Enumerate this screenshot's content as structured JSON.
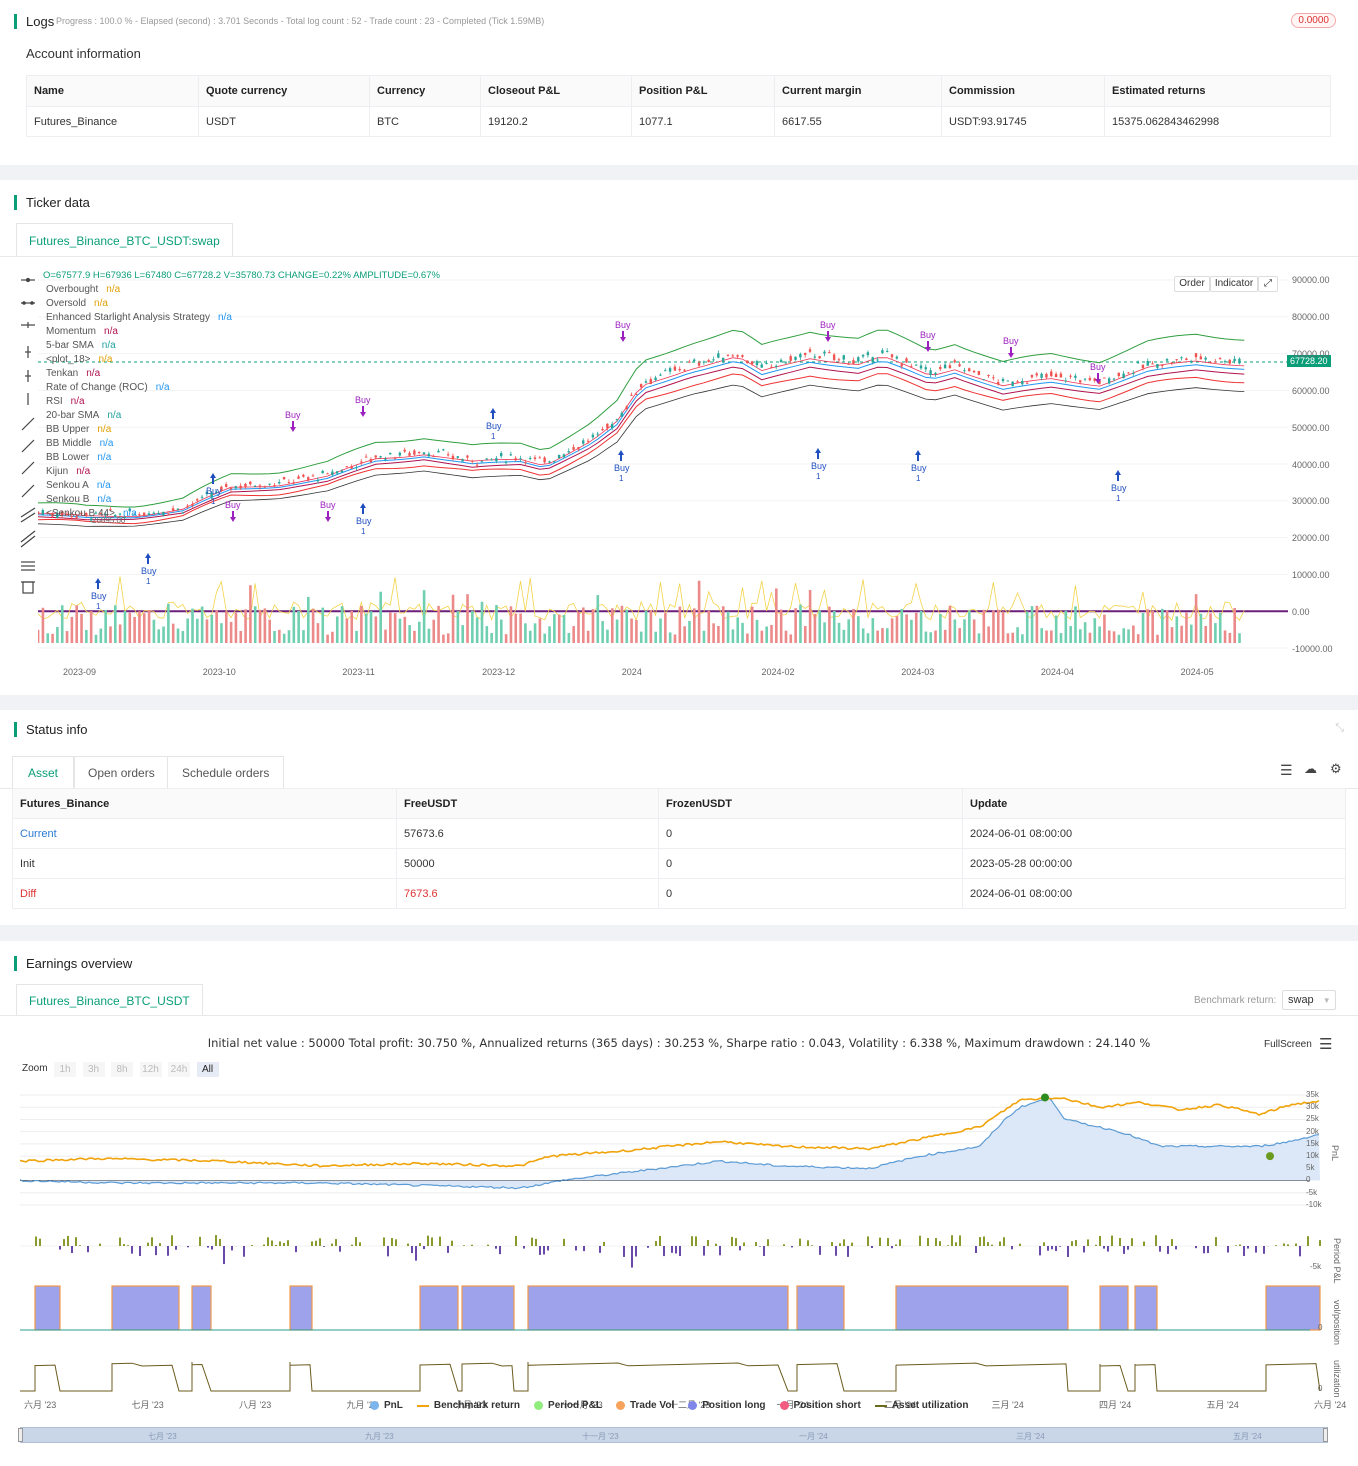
{
  "logs": {
    "title": "Logs",
    "summary": "Progress : 100.0 % - Elapsed (second) : 3.701 Seconds - Total log count : 52 - Trade count : 23 - Completed (Tick 1.59MB)",
    "badge": "0.0000"
  },
  "account": {
    "title": "Account information",
    "columns": [
      "Name",
      "Quote currency",
      "Currency",
      "Closeout P&L",
      "Position P&L",
      "Current margin",
      "Commission",
      "Estimated returns"
    ],
    "row": [
      "Futures_Binance",
      "USDT",
      "BTC",
      "19120.2",
      "1077.1",
      "6617.55",
      "USDT:93.91745",
      "15375.062843462998"
    ]
  },
  "ticker": {
    "title": "Ticker data",
    "tab": "Futures_Binance_BTC_USDT:swap",
    "ohlc": {
      "o": "O=67577.9",
      "h": "H=67936",
      "l": "L=67480",
      "c": "C=67728.2",
      "v": "V=35780.73",
      "change": "CHANGE=0.22%",
      "amp": "AMPLITUDE=0.67%"
    },
    "legend": [
      {
        "name": "Overbought",
        "value": "n/a",
        "color": "#e0a000"
      },
      {
        "name": "Oversold",
        "value": "n/a",
        "color": "#e0a000"
      },
      {
        "name": "Enhanced Starlight Analysis Strategy",
        "value": "n/a",
        "color": "#2196f3"
      },
      {
        "name": "Momentum",
        "value": "n/a",
        "color": "#b0134f"
      },
      {
        "name": "5-bar SMA",
        "value": "n/a",
        "color": "#21a0a0"
      },
      {
        "name": "<plot_18>",
        "value": "n/a",
        "color": "#e0a000"
      },
      {
        "name": "Tenkan",
        "value": "n/a",
        "color": "#b0134f"
      },
      {
        "name": "Rate of Change (ROC)",
        "value": "n/a",
        "color": "#2196f3"
      },
      {
        "name": "RSI",
        "value": "n/a",
        "color": "#b0134f"
      },
      {
        "name": "20-bar SMA",
        "value": "n/a",
        "color": "#21a0a0"
      },
      {
        "name": "BB Upper",
        "value": "n/a",
        "color": "#e0a000"
      },
      {
        "name": "BB Middle",
        "value": "n/a",
        "color": "#2196f3"
      },
      {
        "name": "BB Lower",
        "value": "n/a",
        "color": "#2196f3"
      },
      {
        "name": "Kijun",
        "value": "n/a",
        "color": "#b0134f"
      },
      {
        "name": "Senkou A",
        "value": "n/a",
        "color": "#2196f3"
      },
      {
        "name": "Senkou B",
        "value": "n/a",
        "color": "#2196f3"
      },
      {
        "name": "<Senkou B 44>",
        "value": "n/a",
        "color": "#2196f3"
      }
    ],
    "buttons": {
      "order": "Order",
      "indicator": "Indicator"
    },
    "price_label": "67728.20",
    "y_ticks": [
      "90000.00",
      "80000.00",
      "70000.00",
      "60000.00",
      "50000.00",
      "40000.00",
      "30000.00",
      "20000.00",
      "10000.00",
      "0.00",
      "-10000.00"
    ],
    "x_ticks": [
      "2023-09",
      "2023-10",
      "2023-11",
      "2023-12",
      "2024",
      "2024-02",
      "2024-03",
      "2024-04",
      "2024-05"
    ],
    "markers": [
      {
        "label": "Buy",
        "sub": "1"
      },
      {
        "label": "Buy",
        "sub": ""
      },
      {
        "label": "Buy",
        "sub": "1"
      }
    ],
    "trade_note": "26895.00"
  },
  "status": {
    "title": "Status info",
    "tabs": [
      "Asset",
      "Open orders",
      "Schedule orders"
    ],
    "columns": [
      "Futures_Binance",
      "FreeUSDT",
      "FrozenUSDT",
      "Update"
    ],
    "rows": [
      {
        "name": "Current",
        "free": "57673.6",
        "frozen": "0",
        "update": "2024-06-01 08:00:00"
      },
      {
        "name": "Init",
        "free": "50000",
        "frozen": "0",
        "update": "2023-05-28 00:00:00"
      },
      {
        "name": "Diff",
        "free": "7673.6",
        "frozen": "0",
        "update": "2024-06-01 08:00:00"
      }
    ]
  },
  "earnings": {
    "title": "Earnings overview",
    "tab": "Futures_Binance_BTC_USDT",
    "benchmark_label": "Benchmark return:",
    "benchmark_value": "swap",
    "summary": "Initial net value : 50000 Total profit: 30.750 %, Annualized returns (365 days) : 30.253 %, Sharpe ratio : 0.043, Volatility : 6.338 %, Maximum drawdown : 24.140 %",
    "fullscreen": "FullScreen",
    "zoom_label": "Zoom",
    "zoom": [
      "1h",
      "3h",
      "8h",
      "12h",
      "24h",
      "All"
    ],
    "pnl_ticks": [
      "35k",
      "30k",
      "25k",
      "20k",
      "15k",
      "10k",
      "5k",
      "0",
      "-5k",
      "-10k"
    ],
    "period_tick": "-5k",
    "vol_tick": "0",
    "util_tick": "0",
    "axis_labels": [
      "PnL",
      "Period P&L",
      "vol/position",
      "utilization"
    ],
    "x_ticks": [
      "六月 '23",
      "七月 '23",
      "八月 '23",
      "九月 '23",
      "十月 '23",
      "十一月 '23",
      "十二月 '23",
      "一月 '24",
      "二月 '24",
      "三月 '24",
      "四月 '24",
      "五月 '24",
      "六月 '24"
    ],
    "nav_ticks": [
      "七月 '23",
      "九月 '23",
      "十一月 '23",
      "一月 '24",
      "三月 '24",
      "五月 '24"
    ],
    "legend": [
      {
        "name": "PnL",
        "color": "#7cb5ec"
      },
      {
        "name": "Benchmark return",
        "color": "#f0a30a"
      },
      {
        "name": "Period P&L",
        "color": "#90ed7d"
      },
      {
        "name": "Trade Vol",
        "color": "#f7a35c"
      },
      {
        "name": "Position long",
        "color": "#8085e9"
      },
      {
        "name": "Position short",
        "color": "#f15c80"
      },
      {
        "name": "Asset utilization",
        "color": "#6b6b1e"
      }
    ]
  },
  "colors": {
    "accent": "#0a9e78",
    "up": "#26a69a",
    "down": "#ef5350",
    "pnl": "#5b9bd5",
    "bench": "#f0a30a",
    "position": "#8f95e8"
  }
}
